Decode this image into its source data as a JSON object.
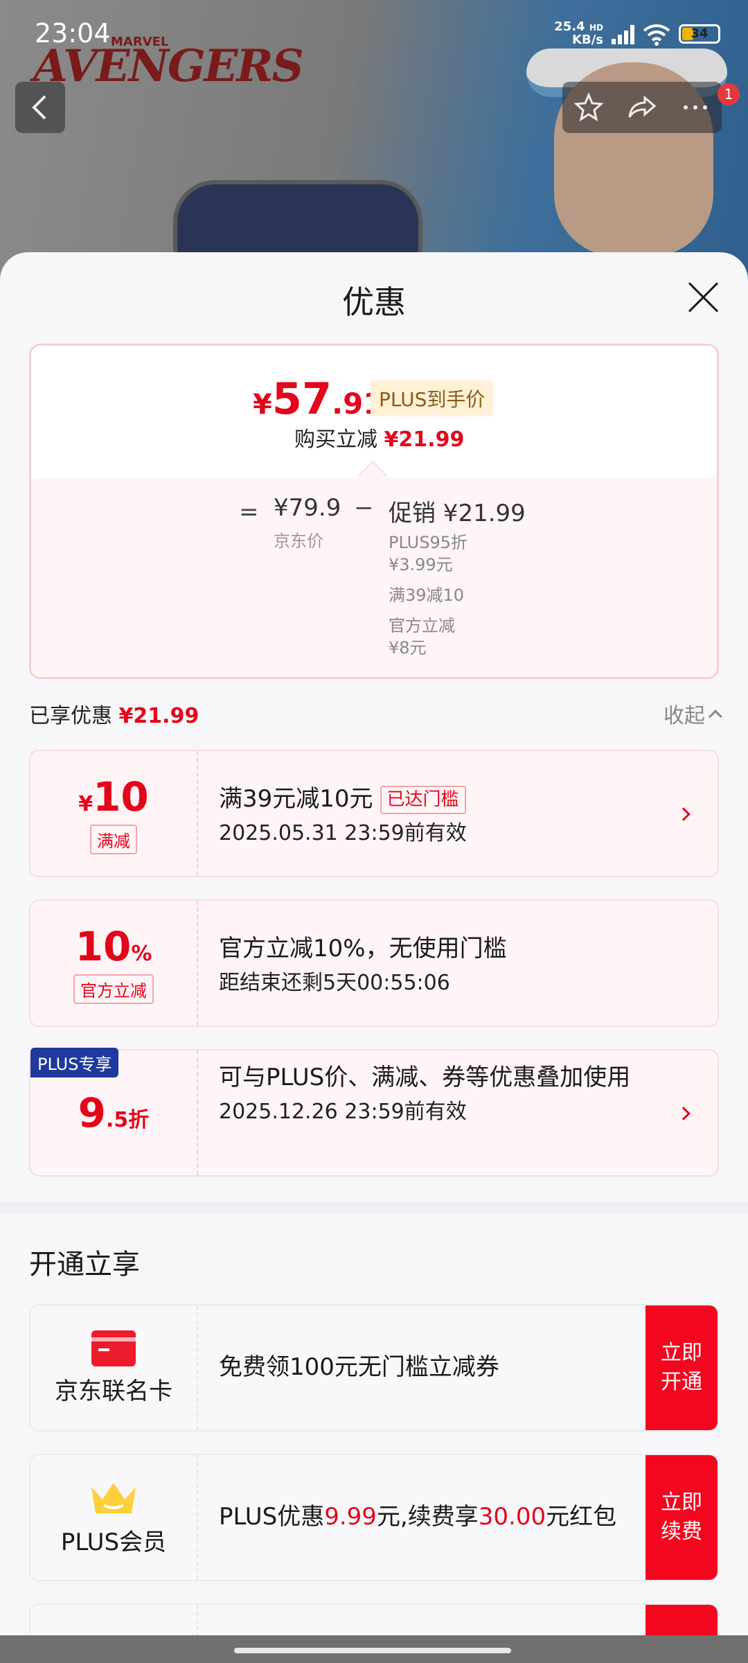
{
  "status": {
    "time": "23:04",
    "net_speed": "25.4",
    "net_unit": "KB/s",
    "network_type": "HD",
    "battery": "34"
  },
  "header": {
    "brand_logo_text": "AVENGERS",
    "brand_small": "MARVEL",
    "notification_count": "1"
  },
  "sheet": {
    "title": "优惠"
  },
  "price_card": {
    "currency": "¥",
    "final_int": "57",
    "final_dec": ".91",
    "plus_tag": "PLUS到手价",
    "reduce_label": "购买立减",
    "reduce_amount": "¥21.99",
    "equals": "=",
    "jd_price": "¥79.9",
    "jd_label": "京东价",
    "minus": "−",
    "promo": "促销 ¥21.99",
    "promo_details": [
      "PLUS95折",
      "¥3.99元",
      "满39减10",
      "官方立减",
      "¥8元"
    ]
  },
  "enjoyed": {
    "label": "已享优惠",
    "amount": "¥21.99",
    "collapse_label": "收起"
  },
  "coupons": [
    {
      "symbol": "¥",
      "amount": "10",
      "unit": "",
      "tag": "满减",
      "title": "满39元减10元",
      "reach_tag": "已达门槛",
      "sub": "2025.05.31 23:59前有效"
    },
    {
      "symbol": "",
      "amount": "10",
      "unit": "%",
      "tag": "官方立减",
      "title": "官方立减10%，无使用门槛",
      "sub": "距结束还剩5天00:55:06"
    },
    {
      "corner": "PLUS专享",
      "amount": "9",
      "unit": ".5折",
      "title": "可与PLUS价、满减、券等优惠叠加使用",
      "sub": "2025.12.26 23:59前有效"
    }
  ],
  "open_section": {
    "title": "开通立享",
    "offers": [
      {
        "name": "京东联名卡",
        "desc": "免费领100元无门槛立减券",
        "cta": "立即开通"
      },
      {
        "name": "PLUS会员",
        "desc_prefix": "PLUS优惠",
        "desc_value1": "9.99",
        "desc_mid": "元,续费享",
        "desc_value2": "30.00",
        "desc_suffix": "元红包",
        "cta": "立即续费"
      }
    ]
  },
  "colors": {
    "accent_red": "#e3061b",
    "plus_blue": "#1f3a9c",
    "plus_gold": "#8b5a1a"
  }
}
